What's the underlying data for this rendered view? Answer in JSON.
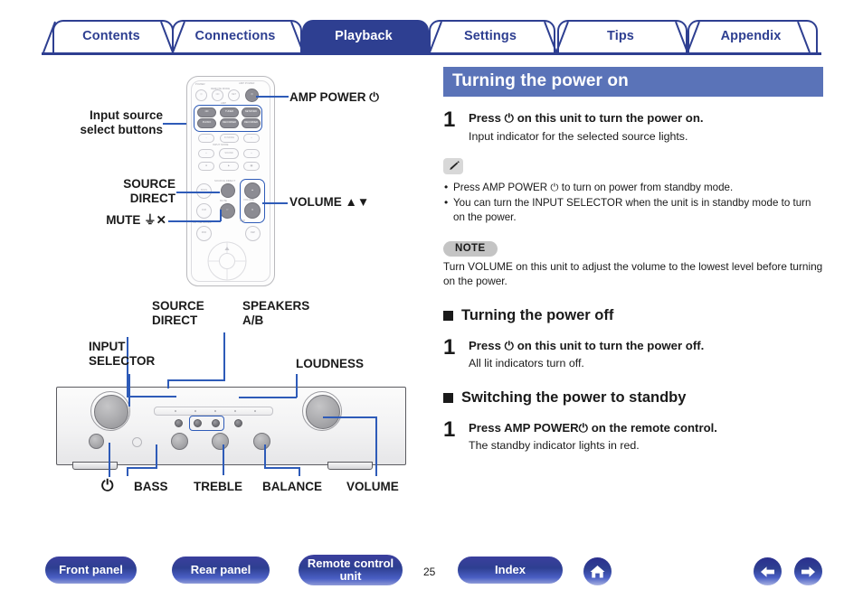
{
  "tabs": [
    {
      "label": "Contents",
      "active": false
    },
    {
      "label": "Connections",
      "active": false
    },
    {
      "label": "Playback",
      "active": true
    },
    {
      "label": "Settings",
      "active": false
    },
    {
      "label": "Tips",
      "active": false
    },
    {
      "label": "Appendix",
      "active": false
    }
  ],
  "content": {
    "section_title": "Turning the power on",
    "step1": {
      "num": "1",
      "title": "Press ⏻ on this unit to turn the power on.",
      "desc": "Input indicator for the selected source lights."
    },
    "tips": [
      "Press AMP POWER ⏻ to turn on power from standby mode.",
      "You can turn the INPUT SELECTOR when the unit is in standby mode to turn on the power."
    ],
    "note": {
      "badge": "NOTE",
      "text": "Turn VOLUME on this unit to adjust the volume to the lowest level before turning on the power."
    },
    "subsection_off": {
      "heading": "Turning the power off",
      "step": {
        "num": "1",
        "title": "Press ⏻ on this unit to turn the power off.",
        "desc": "All lit indicators turn off."
      }
    },
    "subsection_standby": {
      "heading": "Switching the power to standby",
      "step": {
        "num": "1",
        "title": "Press AMP POWER⏻ on the remote control.",
        "desc": "The standby indicator lights in red."
      }
    }
  },
  "diagram": {
    "remote_labels": {
      "amp_power": "AMP POWER ⏻",
      "input_source": "Input source\nselect buttons",
      "source_direct": "SOURCE\nDIRECT",
      "volume": "VOLUME ▲▼",
      "mute": "MUTE ⏚✕"
    },
    "panel_labels": {
      "source_direct": "SOURCE\nDIRECT",
      "speakers_ab": "SPEAKERS\nA/B",
      "input_selector": "INPUT\nSELECTOR",
      "loudness": "LOUDNESS",
      "power": "⏻",
      "bass": "BASS",
      "treble": "TREBLE",
      "balance": "BALANCE",
      "volume": "VOLUME"
    },
    "remote_keys": {
      "top_row_caption": "POWER",
      "amp_power_caption": "AMP POWER",
      "remote_mode_caption": "REMOTE MODE",
      "amp_caption": "AMP",
      "sources": [
        "CD",
        "TUNER",
        "NETWORK",
        "PHONO",
        "RECORDER",
        "RECORDER"
      ],
      "input_mode_caption": "INPUT MODE",
      "source_direct_caption": "SOURCE DIRECT",
      "mute_caption": "MUTE",
      "volume_caption": "VOLUME",
      "amp_bottom_caption": "AMP",
      "cd_caption": "CD / NETWORK"
    }
  },
  "footer": {
    "front_panel": "Front panel",
    "rear_panel": "Rear panel",
    "remote_control": "Remote control\nunit",
    "page_number": "25",
    "index": "Index",
    "home_icon": "home-icon",
    "prev_icon": "arrow-left-icon",
    "next_icon": "arrow-right-icon"
  },
  "colors": {
    "brand_navy": "#2e3f91",
    "header_blue": "#5a73b8",
    "callout_blue": "#2e5bb8"
  }
}
